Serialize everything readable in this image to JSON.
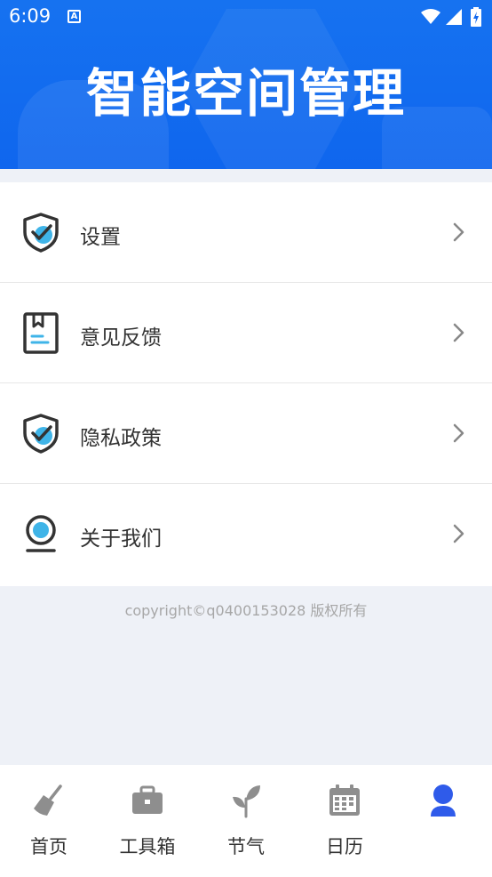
{
  "status_bar": {
    "time": "6:09",
    "notification_icon": "A"
  },
  "header": {
    "title": "智能空间管理"
  },
  "menu": {
    "items": [
      {
        "label": "设置",
        "icon": "shield-check-icon"
      },
      {
        "label": "意见反馈",
        "icon": "feedback-book-icon"
      },
      {
        "label": "隐私政策",
        "icon": "shield-check-icon"
      },
      {
        "label": "关于我们",
        "icon": "about-webcam-icon"
      }
    ]
  },
  "footer": {
    "copyright": "copyright©q0400153028 版权所有"
  },
  "tabbar": {
    "tabs": [
      {
        "label": "首页",
        "icon": "broom-icon",
        "active": false
      },
      {
        "label": "工具箱",
        "icon": "toolbox-icon",
        "active": false
      },
      {
        "label": "节气",
        "icon": "sprout-icon",
        "active": false
      },
      {
        "label": "日历",
        "icon": "calendar-icon",
        "active": false
      },
      {
        "label": "",
        "icon": "user-icon",
        "active": true
      }
    ]
  },
  "colors": {
    "brand_blue": "#0f66ee",
    "accent_light_blue": "#3fb4e8",
    "icon_dark": "#333333",
    "tab_icon_gray": "#8e8e8e",
    "active_tab": "#2f5bea"
  }
}
